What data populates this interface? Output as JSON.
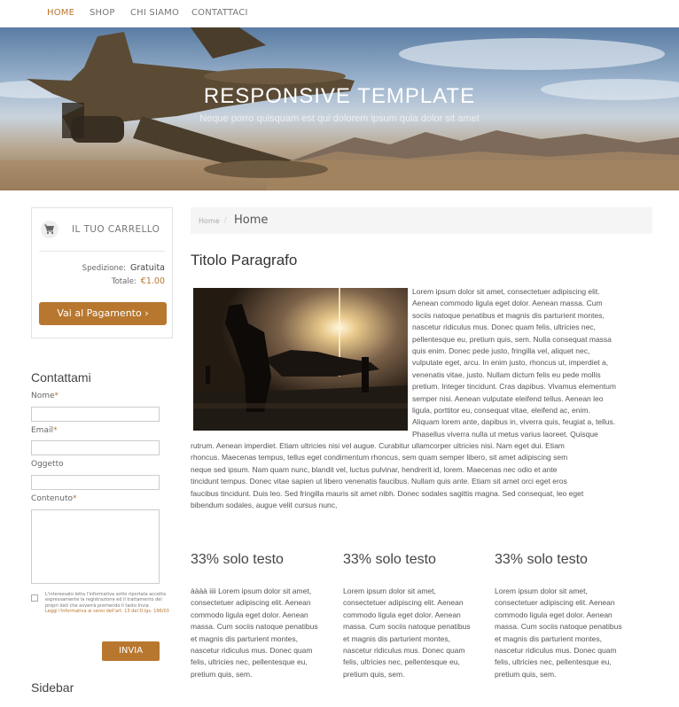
{
  "nav": {
    "items": [
      {
        "label": "HOME",
        "active": true
      },
      {
        "label": "SHOP"
      },
      {
        "label": "CHI SIAMO"
      },
      {
        "label": "CONTATTACI"
      }
    ]
  },
  "hero": {
    "title": "RESPONSIVE TEMPLATE",
    "subtitle": "Neque porro quisquam est qui dolorem ipsum quia dolor sit amet"
  },
  "cart": {
    "title": "IL TUO CARRELLO",
    "shipping_label": "Spedizione:",
    "shipping_value": "Gratuita",
    "total_label": "Totale:",
    "total_value": "€1.00",
    "pay_button": "Vai al Pagamento ›"
  },
  "contact": {
    "title": "Contattami",
    "name_label": "Nome",
    "email_label": "Email",
    "subject_label": "Oggetto",
    "content_label": "Contenuto",
    "required_mark": "*",
    "consent_text": "L'interessato letta l'informativa sotto riportata accetta espressamente la registrazione ed il trattamento dei propri dati che avverrà premendo il tasto Invia",
    "consent_link": "Leggi l'informativa ai sensi dell'art. 13 del D.lgs. 196/03",
    "send_button": "INVIA"
  },
  "sidebar": {
    "title": "Sidebar"
  },
  "breadcrumb": {
    "home": "Home",
    "separator": "/",
    "current": "Home"
  },
  "main": {
    "heading": "Titolo Paragrafo",
    "wrap_lines": [
      "Lorem ipsum dolor sit amet, consectetuer adipiscing elit.",
      "Aenean commodo ligula eget dolor. Aenean massa. Cum",
      "sociis natoque penatibus et magnis dis parturient montes,",
      "nascetur ridiculus mus. Donec quam felis, ultricies nec,",
      "pellentesque eu, pretium quis, sem. Nulla consequat massa",
      "quis enim. Donec pede justo, fringilla vel, aliquet nec,",
      "vulputate eget, arcu. In enim justo, rhoncus ut, imperdiet a,",
      "venenatis vitae, justo. Nullam dictum felis eu pede mollis",
      "pretium. Integer tincidunt. Cras dapibus. Vivamus elementum",
      "semper nisi. Aenean vulputate eleifend tellus. Aenean leo",
      "ligula, porttitor eu, consequat vitae, eleifend ac, enim.",
      "Aliquam lorem ante, dapibus in, viverra quis, feugiat a, tellus.",
      "Phasellus viverra nulla ut metus varius laoreet. Quisque"
    ],
    "full_lines": [
      "rutrum. Aenean imperdiet. Etiam ultricies nisi vel augue. Curabitur ullamcorper ultricies nisi. Nam eget dui. Etiam",
      "rhoncus. Maecenas tempus, tellus eget condimentum rhoncus, sem quam semper libero, sit amet adipiscing sem",
      "neque sed ipsum. Nam quam nunc, blandit vel, luctus pulvinar, hendrerit id, lorem. Maecenas nec odio et ante",
      "tincidunt tempus. Donec vitae sapien ut libero venenatis faucibus. Nullam quis ante. Etiam sit amet orci eget eros",
      "faucibus tincidunt. Duis leo. Sed fringilla mauris sit amet nibh. Donec sodales sagittis magna. Sed consequat, leo eget",
      "bibendum sodales, augue velit cursus nunc,"
    ],
    "columns": [
      {
        "title": "33% solo testo",
        "text": "àààà iiii Lorem ipsum dolor sit amet, consectetuer adipiscing elit. Aenean commodo ligula eget dolor. Aenean massa. Cum sociis natoque penatibus et magnis dis parturient montes, nascetur ridiculus mus. Donec quam felis, ultricies nec, pellentesque eu, pretium quis, sem."
      },
      {
        "title": "33% solo testo",
        "text": "Lorem ipsum dolor sit amet, consectetuer adipiscing elit. Aenean commodo ligula eget dolor. Aenean massa. Cum sociis natoque penatibus et magnis dis parturient montes, nascetur ridiculus mus. Donec quam felis, ultricies nec, pellentesque eu, pretium quis, sem."
      },
      {
        "title": "33% solo testo",
        "text": "Lorem ipsum dolor sit amet, consectetuer adipiscing elit. Aenean commodo ligula eget dolor. Aenean massa. Cum sociis natoque penatibus et magnis dis parturient montes, nascetur ridiculus mus. Donec quam felis, ultricies nec, pellentesque eu, pretium quis, sem."
      }
    ]
  },
  "colors": {
    "accent": "#b8772f",
    "breadcrumb_bg": "#f5f5f5"
  },
  "icons": {
    "cart": "shopping-cart-icon"
  }
}
